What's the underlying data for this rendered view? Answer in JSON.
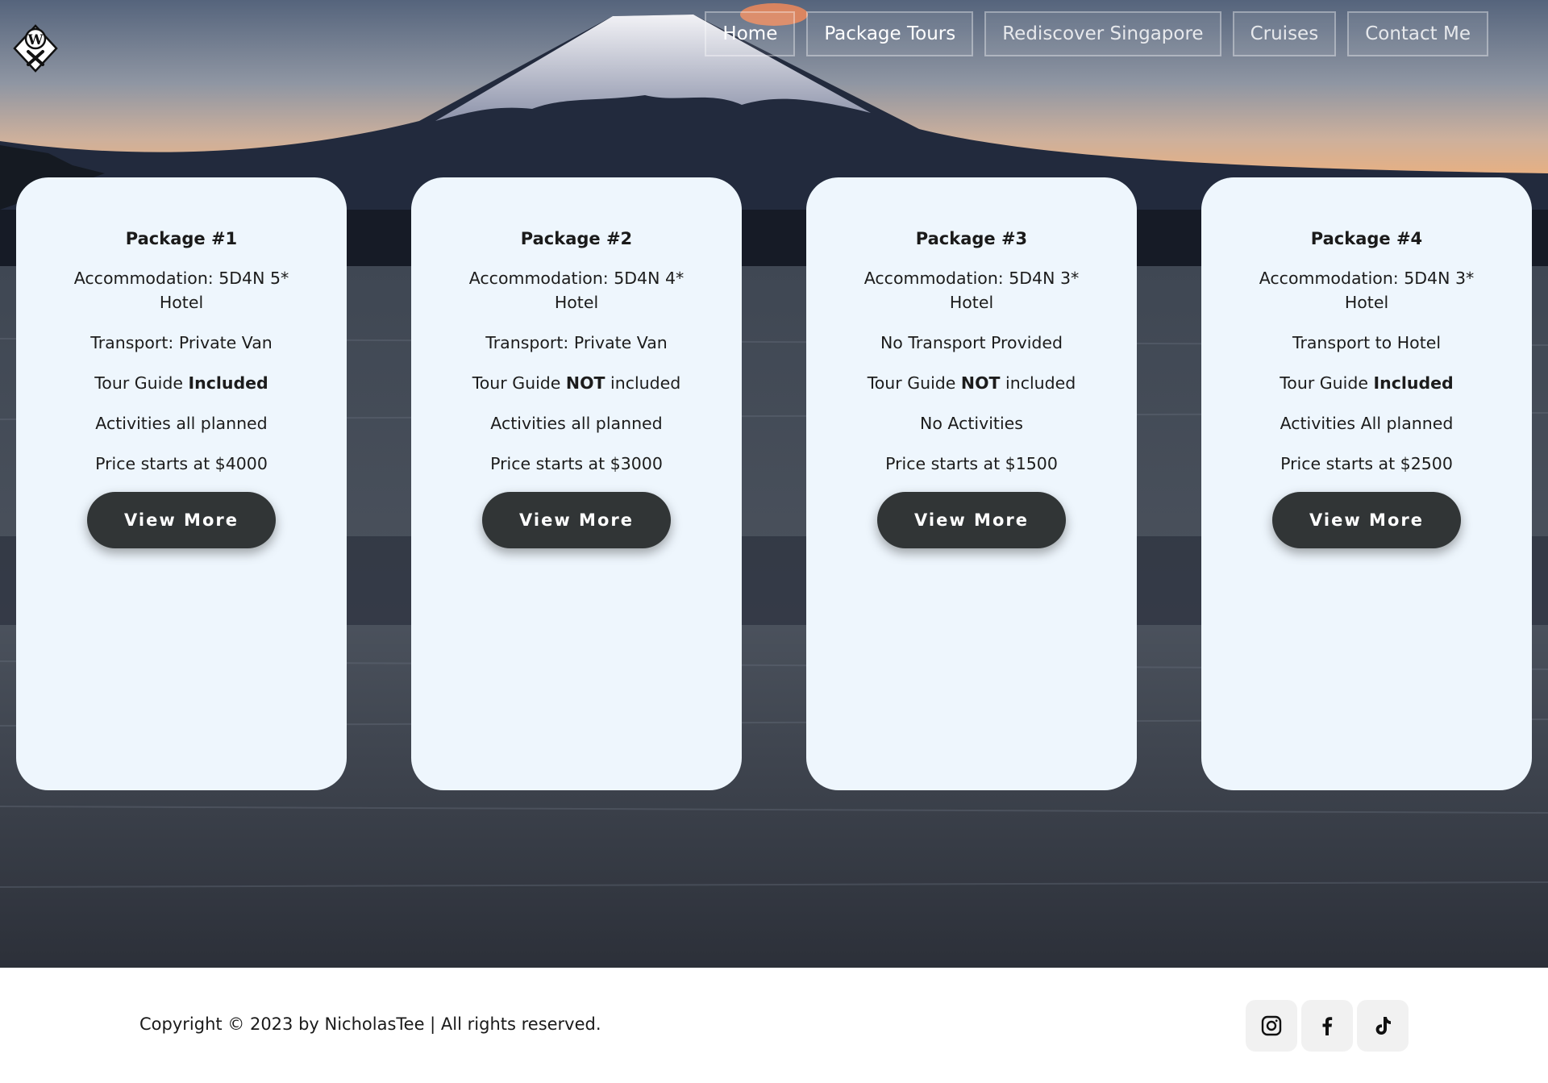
{
  "nav": {
    "items": [
      {
        "label": "Home"
      },
      {
        "label": "Package Tours"
      },
      {
        "label": "Rediscover Singapore"
      },
      {
        "label": "Cruises"
      },
      {
        "label": "Contact Me"
      }
    ]
  },
  "logo": {
    "icon": "wx-diamond-logo-icon",
    "text": "W"
  },
  "packages": [
    {
      "title": "Package #1",
      "accommodation": "Accommodation: 5D4N 5* Hotel",
      "transport": "Transport: Private Van",
      "guide_prefix": "Tour Guide ",
      "guide_emph": "Included",
      "guide_suffix": "",
      "activities": "Activities all planned",
      "price": "Price starts at $4000",
      "button": "View More"
    },
    {
      "title": "Package #2",
      "accommodation": "Accommodation: 5D4N 4* Hotel",
      "transport": "Transport: Private Van",
      "guide_prefix": "Tour Guide ",
      "guide_emph": "NOT",
      "guide_suffix": " included",
      "activities": "Activities all planned",
      "price": "Price starts at $3000",
      "button": "View More"
    },
    {
      "title": "Package #3",
      "accommodation": "Accommodation: 5D4N 3* Hotel",
      "transport": "No Transport Provided",
      "guide_prefix": "Tour Guide ",
      "guide_emph": "NOT",
      "guide_suffix": " included",
      "activities": "No Activities",
      "price": "Price starts at $1500",
      "button": "View More"
    },
    {
      "title": "Package #4",
      "accommodation": "Accommodation: 5D4N 3* Hotel",
      "transport": "Transport to Hotel",
      "guide_prefix": "Tour Guide ",
      "guide_emph": "Included",
      "guide_suffix": "",
      "activities": "Activities All planned",
      "price": "Price starts at $2500",
      "button": "View More"
    }
  ],
  "footer": {
    "copyright": "Copyright © 2023 by NicholasTee | All rights reserved.",
    "socials": [
      {
        "icon": "instagram-icon"
      },
      {
        "icon": "facebook-icon"
      },
      {
        "icon": "tiktok-icon"
      }
    ]
  },
  "colors": {
    "card_bg": "#eef6fd",
    "button_bg": "#313536",
    "footer_bg": "#ffffff"
  }
}
